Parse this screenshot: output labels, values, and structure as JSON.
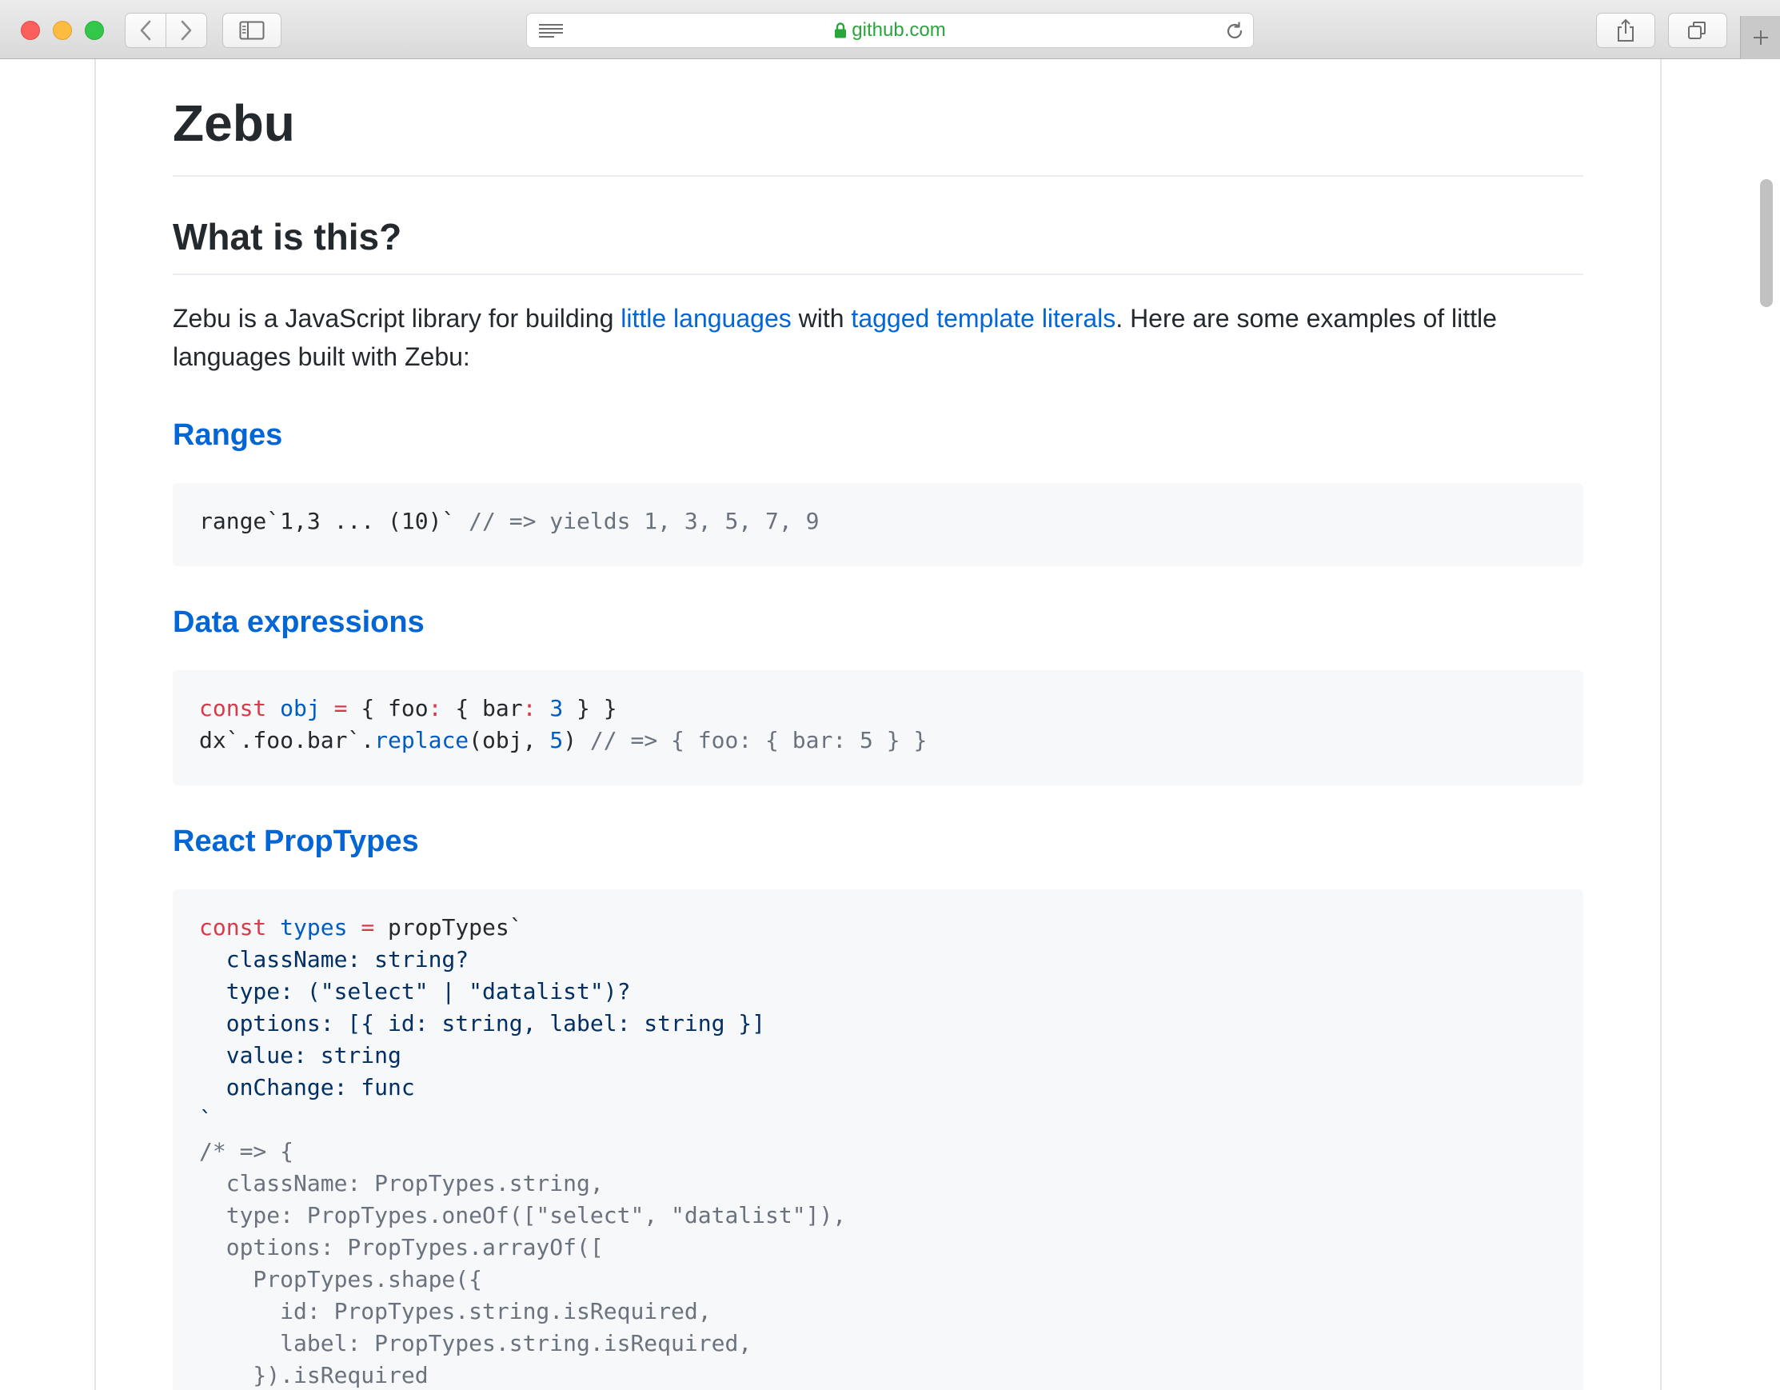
{
  "browser": {
    "url": "github.com",
    "icons": {
      "back": "chevron-left-icon",
      "forward": "chevron-right-icon",
      "sidebar": "sidebar-icon",
      "reader": "reader-icon",
      "lock": "lock-icon",
      "reload": "reload-icon",
      "share": "share-icon",
      "tabs": "tabs-icon",
      "new_tab": "plus-icon"
    },
    "url_color": "#2aa53c"
  },
  "readme": {
    "title": "Zebu",
    "section_heading": "What is this?",
    "intro": {
      "before_link1": "Zebu is a JavaScript library for building ",
      "link1": "little languages",
      "between_links": " with ",
      "link2": "tagged template literals",
      "after_link2": ". Here are some examples of little languages built with Zebu:"
    },
    "examples": [
      {
        "heading": "Ranges",
        "code": {
          "l1_plain": "range`1,3 ... (10)` ",
          "l1_comment": "// => yields 1, 3, 5, 7, 9"
        }
      },
      {
        "heading": "Data expressions",
        "code": {
          "l1_kw": "const",
          "l1_var": "obj",
          "l1_eq": "=",
          "l1_a": "{ foo",
          "l1_colon1": ":",
          "l1_b": " { bar",
          "l1_colon2": ":",
          "l1_num": "3",
          "l1_end": " } }",
          "l2_a": "dx`.foo.bar`.",
          "l2_fn": "replace",
          "l2_b": "(obj, ",
          "l2_num": "5",
          "l2_c": ") ",
          "l2_comment": "// => { foo: { bar: 5 } }"
        }
      },
      {
        "heading": "React PropTypes",
        "code": {
          "l1_kw": "const",
          "l1_var": "types",
          "l1_eq": "=",
          "l1_rest": "propTypes`",
          "template": "  className: string?\n  type: (\"select\" | \"datalist\")?\n  options: [{ id: string, label: string }]\n  value: string\n  onChange: func\n`",
          "comment": "/* => {\n  className: PropTypes.string,\n  type: PropTypes.oneOf([\"select\", \"datalist\"]),\n  options: PropTypes.arrayOf([\n    PropTypes.shape({\n      id: PropTypes.string.isRequired,\n      label: PropTypes.string.isRequired,\n    }).isRequired"
        }
      }
    ]
  },
  "colors": {
    "link": "#0366d6",
    "keyword": "#d73a49",
    "constant": "#005cc5",
    "function": "#6f42c1",
    "string": "#032f62",
    "comment": "#6a737d",
    "code_bg": "#f6f8fa"
  }
}
